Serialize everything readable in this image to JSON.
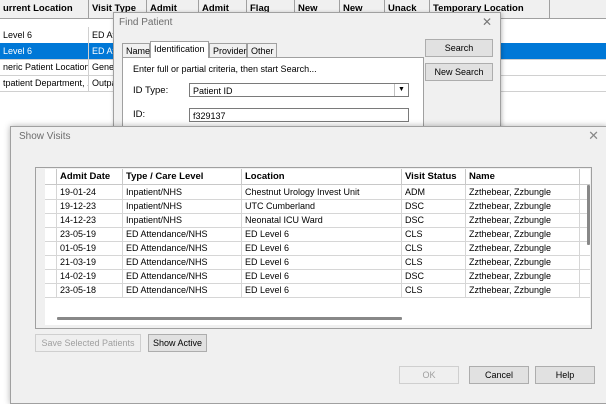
{
  "background_grid": {
    "headers": [
      "urrent Location",
      "Visit Type",
      "Admit",
      "Admit",
      "Flag",
      "New",
      "New",
      "Unack",
      "Temporary Location"
    ],
    "rows": [
      {
        "location": "Level 6",
        "visit_type": "ED At",
        "selected": false
      },
      {
        "location": "Level 6",
        "visit_type": "ED At",
        "selected": true
      },
      {
        "location": "neric Patient Location",
        "visit_type": "Gener",
        "selected": false
      },
      {
        "location": "tpatient Department, ...",
        "visit_type": "Outpa",
        "selected": false
      }
    ]
  },
  "find_patient": {
    "title": "Find Patient",
    "tabs": [
      "Name",
      "Identification",
      "Provider",
      "Other"
    ],
    "active_tab": "Identification",
    "hint": "Enter full or partial criteria, then start Search...",
    "id_type_label": "ID Type:",
    "id_type_value": "Patient ID",
    "id_label": "ID:",
    "id_value": "f329137",
    "search_button": "Search",
    "new_search_button": "New Search"
  },
  "show_visits": {
    "title": "Show Visits",
    "columns": [
      "Admit Date",
      "Type / Care Level",
      "Location",
      "Visit Status",
      "Name"
    ],
    "rows": [
      [
        "19-01-24",
        "Inpatient/NHS",
        "Chestnut Urology Invest Unit",
        "ADM",
        "Zzthebear, Zzbungle"
      ],
      [
        "19-12-23",
        "Inpatient/NHS",
        "UTC Cumberland",
        "DSC",
        "Zzthebear, Zzbungle"
      ],
      [
        "14-12-23",
        "Inpatient/NHS",
        "Neonatal ICU Ward",
        "DSC",
        "Zzthebear, Zzbungle"
      ],
      [
        "23-05-19",
        "ED Attendance/NHS",
        "ED Level 6",
        "CLS",
        "Zzthebear, Zzbungle"
      ],
      [
        "01-05-19",
        "ED Attendance/NHS",
        "ED Level 6",
        "CLS",
        "Zzthebear, Zzbungle"
      ],
      [
        "21-03-19",
        "ED Attendance/NHS",
        "ED Level 6",
        "CLS",
        "Zzthebear, Zzbungle"
      ],
      [
        "14-02-19",
        "ED Attendance/NHS",
        "ED Level 6",
        "DSC",
        "Zzthebear, Zzbungle"
      ],
      [
        "23-05-18",
        "ED Attendance/NHS",
        "ED Level 6",
        "CLS",
        "Zzthebear, Zzbungle"
      ]
    ],
    "save_selected_button": "Save Selected Patients",
    "show_active_button": "Show Active",
    "ok_button": "OK",
    "cancel_button": "Cancel",
    "help_button": "Help"
  },
  "icons": {
    "close": "close-icon",
    "dropdown": "chevron-down-icon"
  },
  "colors": {
    "selection": "#0078d7",
    "dialog_bg": "#f0f0f0"
  }
}
